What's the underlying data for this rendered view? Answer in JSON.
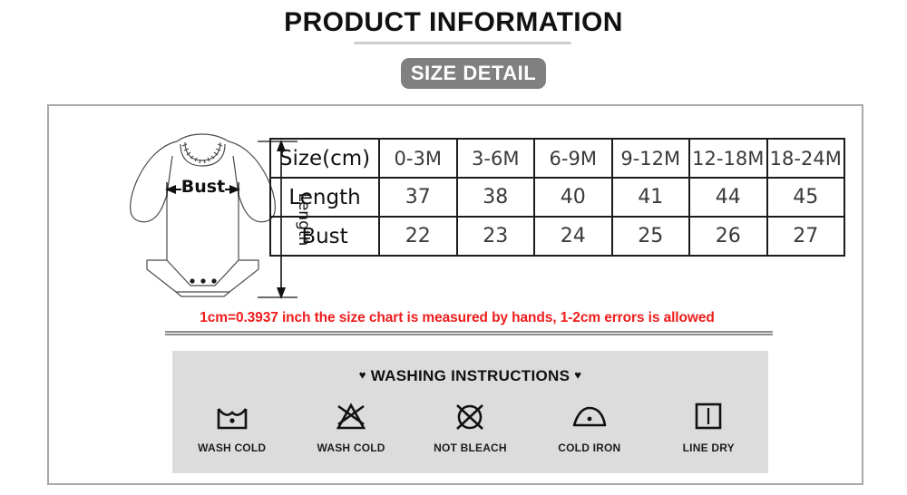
{
  "header": {
    "title": "PRODUCT INFORMATION",
    "badge_label": "SIZE DETAIL"
  },
  "illustration": {
    "bust_label": "Bust",
    "length_label": "Length",
    "garment": "baby-long-sleeve-bodysuit"
  },
  "size_chart": {
    "columns": [
      "Size(cm)",
      "0-3M",
      "3-6M",
      "6-9M",
      "9-12M",
      "12-18M",
      "18-24M"
    ],
    "rows": [
      {
        "label": "Length",
        "values": [
          "37",
          "38",
          "40",
          "41",
          "44",
          "45"
        ]
      },
      {
        "label": "Bust",
        "values": [
          "22",
          "23",
          "24",
          "25",
          "26",
          "27"
        ]
      }
    ]
  },
  "measure_note": {
    "text": "1cm=0.3937 inch the size chart is measured by hands, 1-2cm errors is allowed",
    "color": "#ee1c1c"
  },
  "washing": {
    "title": "WASHING INSTRUCTIONS",
    "heart": "♥",
    "panel_color": "#dcdcdc",
    "icons": [
      {
        "label": "WASH COLD",
        "icon": "wash-tub-one-dot-icon"
      },
      {
        "label": "WASH COLD",
        "icon": "do-not-bleach-triangle-icon"
      },
      {
        "label": "NOT BLEACH",
        "icon": "do-not-bleach-circle-icon"
      },
      {
        "label": "COLD IRON",
        "icon": "iron-one-dot-icon"
      },
      {
        "label": "LINE DRY",
        "icon": "line-dry-square-icon"
      }
    ]
  }
}
